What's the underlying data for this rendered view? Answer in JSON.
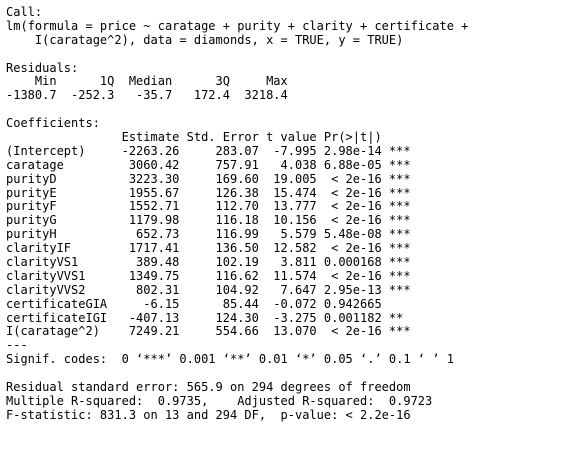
{
  "call": {
    "header": "Call:",
    "line1": "lm(formula = price ~ caratage + purity + clarity + certificate +",
    "line2": "    I(caratage^2), data = diamonds, x = TRUE, y = TRUE)"
  },
  "residuals": {
    "header": "Residuals:",
    "labels": "    Min      1Q  Median      3Q     Max ",
    "values": "-1380.7  -252.3   -35.7   172.4  3218.4 "
  },
  "coefficients": {
    "header": "Coefficients:",
    "columns": "                Estimate Std. Error t value Pr(>|t|)    ",
    "rows": [
      {
        "term": "(Intercept)     ",
        "rest": "-2263.26     283.07  -7.995 2.98e-14 ***"
      },
      {
        "term": "caratage        ",
        "rest": " 3060.42     757.91   4.038 6.88e-05 ***"
      },
      {
        "term": "purityD         ",
        "rest": " 3223.30     169.60  19.005  < 2e-16 ***"
      },
      {
        "term": "purityE         ",
        "rest": " 1955.67     126.38  15.474  < 2e-16 ***"
      },
      {
        "term": "purityF         ",
        "rest": " 1552.71     112.70  13.777  < 2e-16 ***"
      },
      {
        "term": "purityG         ",
        "rest": " 1179.98     116.18  10.156  < 2e-16 ***"
      },
      {
        "term": "purityH         ",
        "rest": "  652.73     116.99   5.579 5.48e-08 ***"
      },
      {
        "term": "clarityIF       ",
        "rest": " 1717.41     136.50  12.582  < 2e-16 ***"
      },
      {
        "term": "clarityVS1      ",
        "rest": "  389.48     102.19   3.811 0.000168 ***"
      },
      {
        "term": "clarityVVS1     ",
        "rest": " 1349.75     116.62  11.574  < 2e-16 ***"
      },
      {
        "term": "clarityVVS2     ",
        "rest": "  802.31     104.92   7.647 2.95e-13 ***"
      },
      {
        "term": "certificateGIA  ",
        "rest": "   -6.15      85.44  -0.072 0.942665    "
      },
      {
        "term": "certificateIGI  ",
        "rest": " -407.13     124.30  -3.275 0.001182 ** "
      },
      {
        "term": "I(caratage^2)   ",
        "rest": " 7249.21     554.66  13.070  < 2e-16 ***"
      }
    ],
    "separator": "---",
    "signif": "Signif. codes:  0 ‘***’ 0.001 ‘**’ 0.01 ‘*’ 0.05 ‘.’ 0.1 ‘ ’ 1"
  },
  "summary": {
    "rse": "Residual standard error: 565.9 on 294 degrees of freedom",
    "r2": "Multiple R-squared:  0.9735,    Adjusted R-squared:  0.9723 ",
    "fstat": "F-statistic: 831.3 on 13 and 294 DF,  p-value: < 2.2e-16"
  }
}
